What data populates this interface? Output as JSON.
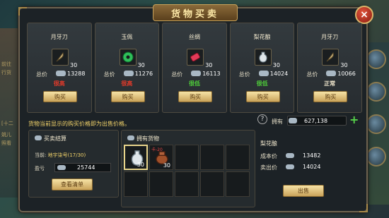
{
  "window": {
    "title": "货物买卖",
    "close_glyph": "×"
  },
  "goods": [
    {
      "name": "月牙刀",
      "qty": "30",
      "price_label": "总价",
      "price": "13288",
      "status": "很高",
      "status_color": "#e03a2a",
      "buy_label": "购买",
      "icon": "crescent-blade-icon"
    },
    {
      "name": "玉佩",
      "qty": "30",
      "price_label": "总价",
      "price": "11276",
      "status": "很高",
      "status_color": "#e03a2a",
      "buy_label": "购买",
      "icon": "jade-pendant-icon"
    },
    {
      "name": "丝绸",
      "qty": "30",
      "price_label": "总价",
      "price": "16113",
      "status": "很低",
      "status_color": "#4ecb3a",
      "buy_label": "购买",
      "icon": "silk-roll-icon"
    },
    {
      "name": "梨花酿",
      "qty": "30",
      "price_label": "总价",
      "price": "14024",
      "status": "很低",
      "status_color": "#4ecb3a",
      "buy_label": "购买",
      "icon": "wine-jug-icon"
    },
    {
      "name": "月牙刀",
      "qty": "30",
      "price_label": "总价",
      "price": "10066",
      "status": "正常",
      "status_color": "#f2e9cf",
      "buy_label": "购买",
      "icon": "crescent-blade-icon"
    }
  ],
  "notice": "货物当前显示的购买价格即为出售价格。",
  "owned_currency": {
    "label": "拥有",
    "value": "627,138"
  },
  "settlement": {
    "header": "买卖结算",
    "location_label": "当前:",
    "location_value": "地宇柒号(17/30)",
    "pl_label": "盈亏",
    "pl_value": "25744",
    "list_button": "查看清单"
  },
  "owned_goods": {
    "header": "拥有货物",
    "items": [
      {
        "qty": "30",
        "tag": "",
        "icon": "wine-jug-icon",
        "selected": true
      },
      {
        "qty": "30",
        "tag": "卡-20",
        "icon": "clay-pot-icon",
        "selected": false
      }
    ]
  },
  "detail": {
    "name": "梨花酿",
    "cost_label": "成本价",
    "cost_value": "13482",
    "sell_label": "卖出价",
    "sell_value": "14024",
    "sell_button": "出售"
  },
  "bg_sidebar": [
    "前往",
    "行货",
    "[十二",
    "姚儿",
    "照看"
  ]
}
